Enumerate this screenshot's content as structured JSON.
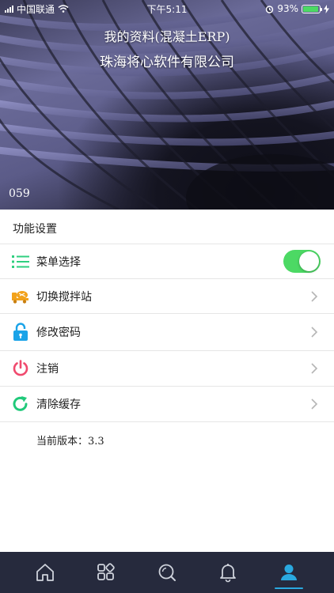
{
  "status_bar": {
    "carrier": "中国联通",
    "time": "下午5:11",
    "battery_percent": "93%",
    "battery_level": 0.93
  },
  "header": {
    "title": "我的资料(混凝土ERP)",
    "company": "珠海将心软件有限公司",
    "user_code": "059"
  },
  "settings": {
    "section_title": "功能设置",
    "items": [
      {
        "label": "菜单选择",
        "icon": "list-icon",
        "control": "toggle",
        "toggle_on": true
      },
      {
        "label": "切换搅拌站",
        "icon": "mixer-truck-icon",
        "control": "chevron"
      },
      {
        "label": "修改密码",
        "icon": "lock-icon",
        "control": "chevron"
      },
      {
        "label": "注销",
        "icon": "power-icon",
        "control": "chevron"
      },
      {
        "label": "清除缓存",
        "icon": "refresh-icon",
        "control": "chevron"
      }
    ],
    "version_label": "当前版本：",
    "version_value": "3.3"
  },
  "tabbar": {
    "tabs": [
      {
        "name": "home-icon",
        "active": false
      },
      {
        "name": "apps-grid-icon",
        "active": false
      },
      {
        "name": "search-icon",
        "active": false
      },
      {
        "name": "bell-icon",
        "active": false
      },
      {
        "name": "user-icon",
        "active": true
      }
    ],
    "active_color": "#2aa9e0",
    "background": "#262a3d"
  },
  "colors": {
    "toggle_on": "#4cd964",
    "list_icon": "#2fcf7f",
    "mixer_icon": "#f2a21b",
    "lock_icon": "#1aa3e8",
    "power_icon": "#f04a6e",
    "refresh_icon": "#20c97a"
  }
}
